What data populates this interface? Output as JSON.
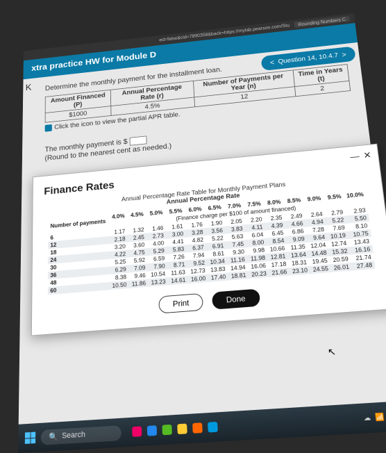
{
  "browser": {
    "tab_fragment": "ed=false&cid=7890358&back=https://mylab.pearson.com/Stu",
    "tab_title": "Rounding Numbers C"
  },
  "course_header": "xtra practice HW for Module D",
  "back_label": "K",
  "question_pill": {
    "prev": "<",
    "label": "Question 14, 10.4.7",
    "next": ">"
  },
  "prompt": "Determine the monthly payment for the installment loan.",
  "given": {
    "headers": {
      "amount": "Amount Financed (P)",
      "apr": "Annual Percentage Rate (r)",
      "n": "Number of Payments per Year (n)",
      "t": "Time in Years (t)"
    },
    "values": {
      "amount": "$1000",
      "apr": "4.5%",
      "n": "12",
      "t": "2"
    }
  },
  "icon_line": "Click the icon to view the partial APR table.",
  "answer": {
    "line1a": "The monthly payment is $",
    "line2": "(Round to the nearest cent as needed.)"
  },
  "modal": {
    "title": "Finance Rates",
    "caption1": "Annual Percentage Rate Table for Monthly Payment Plans",
    "caption2": "Annual Percentage Rate",
    "subcaption": "(Finance charge per $100 of amount financed)",
    "num_payments_label": "Number of payments",
    "print": "Print",
    "done": "Done"
  },
  "chart_data": {
    "type": "table",
    "title": "Annual Percentage Rate Table for Monthly Payment Plans",
    "xlabel": "Annual Percentage Rate",
    "ylabel": "Number of payments",
    "columns": [
      "4.0%",
      "4.5%",
      "5.0%",
      "5.5%",
      "6.0%",
      "6.5%",
      "7.0%",
      "7.5%",
      "8.0%",
      "8.5%",
      "9.0%",
      "9.5%",
      "10.0%"
    ],
    "rows": [
      {
        "n": 6,
        "v": [
          1.17,
          1.32,
          1.46,
          1.61,
          1.76,
          1.9,
          2.05,
          2.2,
          2.35,
          2.49,
          2.64,
          2.79,
          2.93
        ]
      },
      {
        "n": 12,
        "v": [
          2.18,
          2.45,
          2.73,
          3.0,
          3.28,
          3.56,
          3.83,
          4.11,
          4.39,
          4.66,
          4.94,
          5.22,
          5.5
        ]
      },
      {
        "n": 18,
        "v": [
          3.2,
          3.6,
          4.0,
          4.41,
          4.82,
          5.22,
          5.63,
          6.04,
          6.45,
          6.86,
          7.28,
          7.69,
          8.1
        ]
      },
      {
        "n": 24,
        "v": [
          4.22,
          4.75,
          5.29,
          5.83,
          6.37,
          6.91,
          7.45,
          8.0,
          8.54,
          9.09,
          9.64,
          10.19,
          10.75
        ]
      },
      {
        "n": 30,
        "v": [
          5.25,
          5.92,
          6.59,
          7.26,
          7.94,
          8.61,
          9.3,
          9.98,
          10.66,
          11.35,
          12.04,
          12.74,
          13.43
        ]
      },
      {
        "n": 36,
        "v": [
          6.29,
          7.09,
          7.9,
          8.71,
          9.52,
          10.34,
          11.16,
          11.98,
          12.81,
          13.64,
          14.48,
          15.32,
          16.16
        ]
      },
      {
        "n": 48,
        "v": [
          8.38,
          9.46,
          10.54,
          11.63,
          12.73,
          13.83,
          14.94,
          16.06,
          17.18,
          18.31,
          19.45,
          20.59,
          21.74
        ]
      },
      {
        "n": 60,
        "v": [
          10.5,
          11.86,
          13.23,
          14.61,
          16.0,
          17.4,
          18.81,
          20.23,
          21.66,
          23.1,
          24.55,
          26.01,
          27.48
        ]
      }
    ]
  },
  "taskbar": {
    "search": "Search"
  }
}
